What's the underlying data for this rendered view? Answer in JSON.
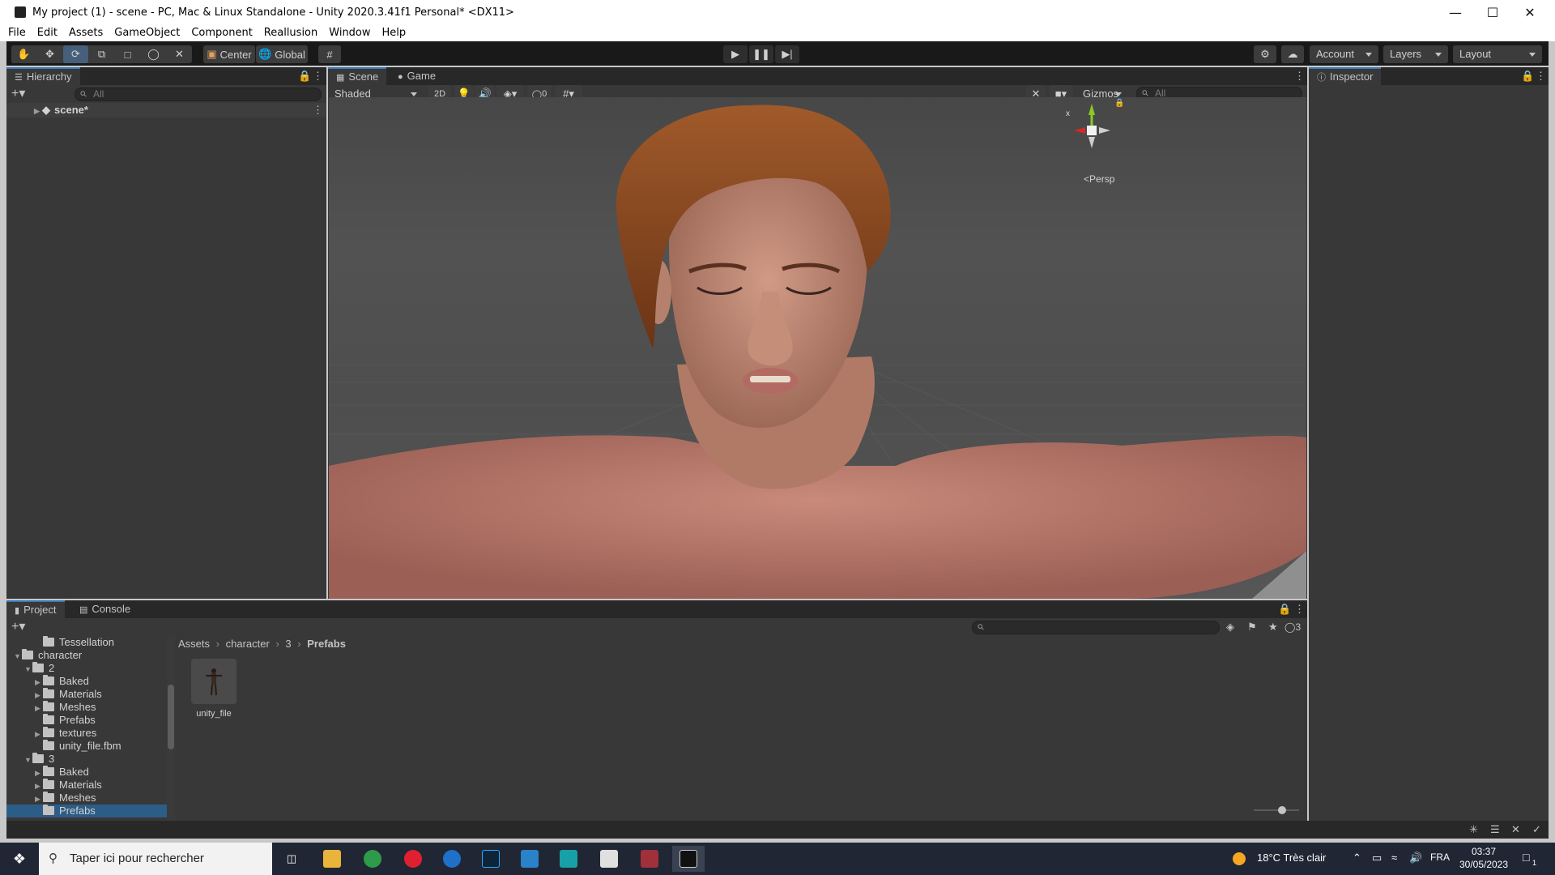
{
  "window": {
    "title": "My project (1) - scene - PC, Mac & Linux Standalone - Unity 2020.3.41f1 Personal* <DX11>",
    "minimize": "—",
    "maximize": "☐",
    "close": "✕"
  },
  "menu": [
    "File",
    "Edit",
    "Assets",
    "GameObject",
    "Component",
    "Reallusion",
    "Window",
    "Help"
  ],
  "toolbar": {
    "pivot": "Center",
    "space": "Global",
    "account": "Account",
    "layers": "Layers",
    "layout": "Layout"
  },
  "hierarchy": {
    "tab": "Hierarchy",
    "search_placeholder": "All",
    "scene_item": "scene*"
  },
  "scene": {
    "tabs": [
      "Scene",
      "Game"
    ],
    "shading": "Shaded",
    "mode_2d": "2D",
    "hidden_count": "0",
    "gizmos": "Gizmos",
    "search_placeholder": "All",
    "persp": "Persp",
    "axis_y": "y",
    "axis_x": "x"
  },
  "inspector": {
    "tab": "Inspector"
  },
  "project": {
    "tabs": [
      "Project",
      "Console"
    ],
    "tree": [
      {
        "label": "Tessellation",
        "depth": 3,
        "expand": ""
      },
      {
        "label": "character",
        "depth": 1,
        "expand": "open"
      },
      {
        "label": "2",
        "depth": 2,
        "expand": "open"
      },
      {
        "label": "Baked",
        "depth": 3,
        "expand": "closed"
      },
      {
        "label": "Materials",
        "depth": 3,
        "expand": "closed"
      },
      {
        "label": "Meshes",
        "depth": 3,
        "expand": "closed"
      },
      {
        "label": "Prefabs",
        "depth": 3,
        "expand": ""
      },
      {
        "label": "textures",
        "depth": 3,
        "expand": "closed"
      },
      {
        "label": "unity_file.fbm",
        "depth": 3,
        "expand": ""
      },
      {
        "label": "3",
        "depth": 2,
        "expand": "open"
      },
      {
        "label": "Baked",
        "depth": 3,
        "expand": "closed"
      },
      {
        "label": "Materials",
        "depth": 3,
        "expand": "closed"
      },
      {
        "label": "Meshes",
        "depth": 3,
        "expand": "closed"
      },
      {
        "label": "Prefabs",
        "depth": 3,
        "expand": "",
        "selected": true
      }
    ],
    "breadcrumb": [
      "Assets",
      "character",
      "3",
      "Prefabs"
    ],
    "asset_name": "unity_file",
    "hidden_count": "3"
  },
  "taskbar": {
    "search_placeholder": "Taper ici pour rechercher",
    "weather": "18°C  Très clair",
    "language": "FRA",
    "time": "03:37",
    "date": "30/05/2023",
    "notifications": "1"
  },
  "colors": {
    "editor_bg": "#383838",
    "tab_bar": "#282828",
    "accent": "#3a79bb",
    "selection": "#2c5d87"
  }
}
